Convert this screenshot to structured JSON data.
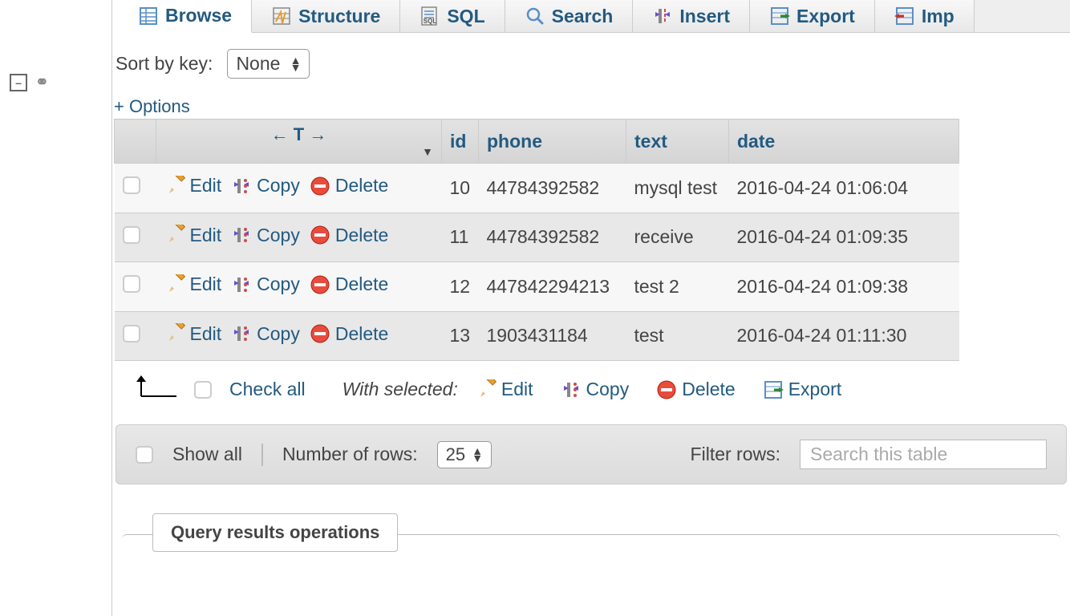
{
  "tabs": {
    "browse": "Browse",
    "structure": "Structure",
    "sql": "SQL",
    "search": "Search",
    "insert": "Insert",
    "export": "Export",
    "import": "Imp"
  },
  "sort_by_key": {
    "label": "Sort by key:",
    "value": "None"
  },
  "options_label": "+ Options",
  "columns": {
    "id": "id",
    "phone": "phone",
    "text": "text",
    "date": "date"
  },
  "row_actions": {
    "edit": "Edit",
    "copy": "Copy",
    "delete": "Delete"
  },
  "rows": [
    {
      "id": "10",
      "phone": "44784392582",
      "text": "mysql test",
      "date": "2016-04-24 01:06:04"
    },
    {
      "id": "11",
      "phone": "44784392582",
      "text": "receive",
      "date": "2016-04-24 01:09:35"
    },
    {
      "id": "12",
      "phone": "447842294213",
      "text": "test 2",
      "date": "2016-04-24 01:09:38"
    },
    {
      "id": "13",
      "phone": "1903431184",
      "text": "test",
      "date": "2016-04-24 01:11:30"
    }
  ],
  "bulk": {
    "check_all": "Check all",
    "with_selected": "With selected:",
    "edit": "Edit",
    "copy": "Copy",
    "delete": "Delete",
    "export": "Export"
  },
  "bottombar": {
    "show_all": "Show all",
    "num_rows_label": "Number of rows:",
    "num_rows_value": "25",
    "filter_label": "Filter rows:",
    "filter_placeholder": "Search this table"
  },
  "fieldset": {
    "legend": "Query results operations"
  }
}
